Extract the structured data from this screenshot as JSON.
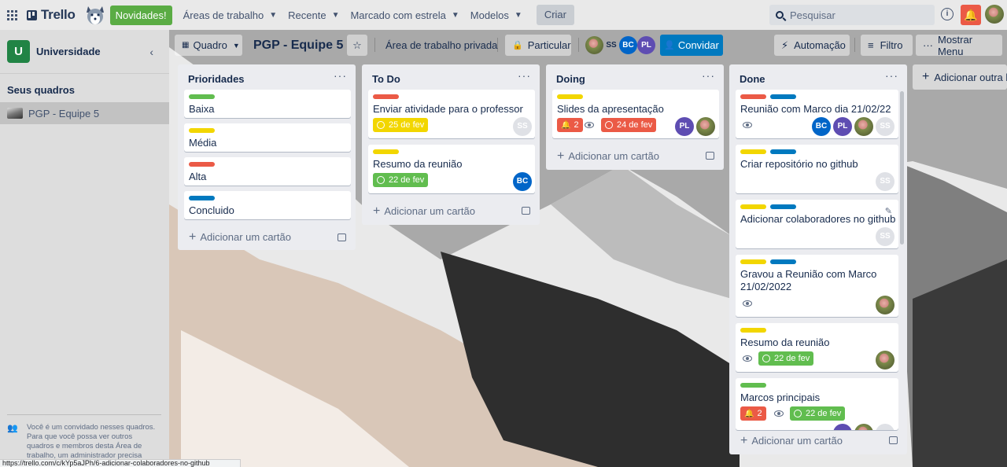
{
  "topnav": {
    "brand": "Trello",
    "news": "Novidades!",
    "menus": [
      "Áreas de trabalho",
      "Recente",
      "Marcado com estrela",
      "Modelos"
    ],
    "create": "Criar",
    "search_placeholder": "Pesquisar",
    "info_icon": "i"
  },
  "sidebar": {
    "workspace_initial": "U",
    "workspace_name": "Universidade",
    "boards_heading": "Seus quadros",
    "boards": [
      "PGP - Equipe 5"
    ],
    "guest_notice": "Você é um convidado nesses quadros. Para que você possa ver outros quadros e membros desta Área de trabalho, um administrador precisa adicionar você"
  },
  "board_header": {
    "view": "Quadro",
    "title": "PGP - Equipe 5",
    "workspace_visibility": "Área de trabalho privada",
    "visibility": "Particular",
    "members": [
      "SS",
      "BC",
      "PL"
    ],
    "invite": "Convidar",
    "automation": "Automação",
    "filter": "Filtro",
    "menu": "Mostrar Menu"
  },
  "lists": {
    "prioridades": {
      "title": "Prioridades",
      "cards": [
        "Baixa",
        "Média",
        "Alta",
        "Concluido"
      ],
      "add": "Adicionar um cartão"
    },
    "todo": {
      "title": "To Do",
      "card1": {
        "text": "Enviar atividade para o professor",
        "due": "25 de fev",
        "member": "SS"
      },
      "card2": {
        "text": "Resumo da reunião",
        "due": "22 de fev",
        "member": "BC"
      },
      "add": "Adicionar um cartão"
    },
    "doing": {
      "title": "Doing",
      "card1": {
        "text": "Slides da apresentação",
        "notifications": "2",
        "due": "24 de fev",
        "member": "PL"
      },
      "add": "Adicionar um cartão"
    },
    "done": {
      "title": "Done",
      "card1": {
        "text": "Reunião com Marco dia 21/02/22",
        "members": [
          "BC",
          "PL",
          "SS"
        ]
      },
      "card2": {
        "text": "Criar repositório no github",
        "member": "SS"
      },
      "card3": {
        "text": "Adicionar colaboradores no github",
        "member": "SS"
      },
      "card4": {
        "text": "Gravou a Reunião com Marco 21/02/2022"
      },
      "card5": {
        "text": "Resumo da reunião",
        "due": "22 de fev"
      },
      "card6": {
        "text": "Marcos principais",
        "notifications": "2",
        "due": "22 de fev"
      },
      "add": "Adicionar um cartão"
    }
  },
  "add_list": "Adicionar outra lista",
  "status_url": "https://trello.com/c/kYp5aJPh/6-adicionar-colaboradores-no-github",
  "colors": {
    "green": "#61bd4f",
    "yellow": "#f2d600",
    "red": "#eb5a46",
    "blue": "#0079bf",
    "workspace": "#218445"
  }
}
